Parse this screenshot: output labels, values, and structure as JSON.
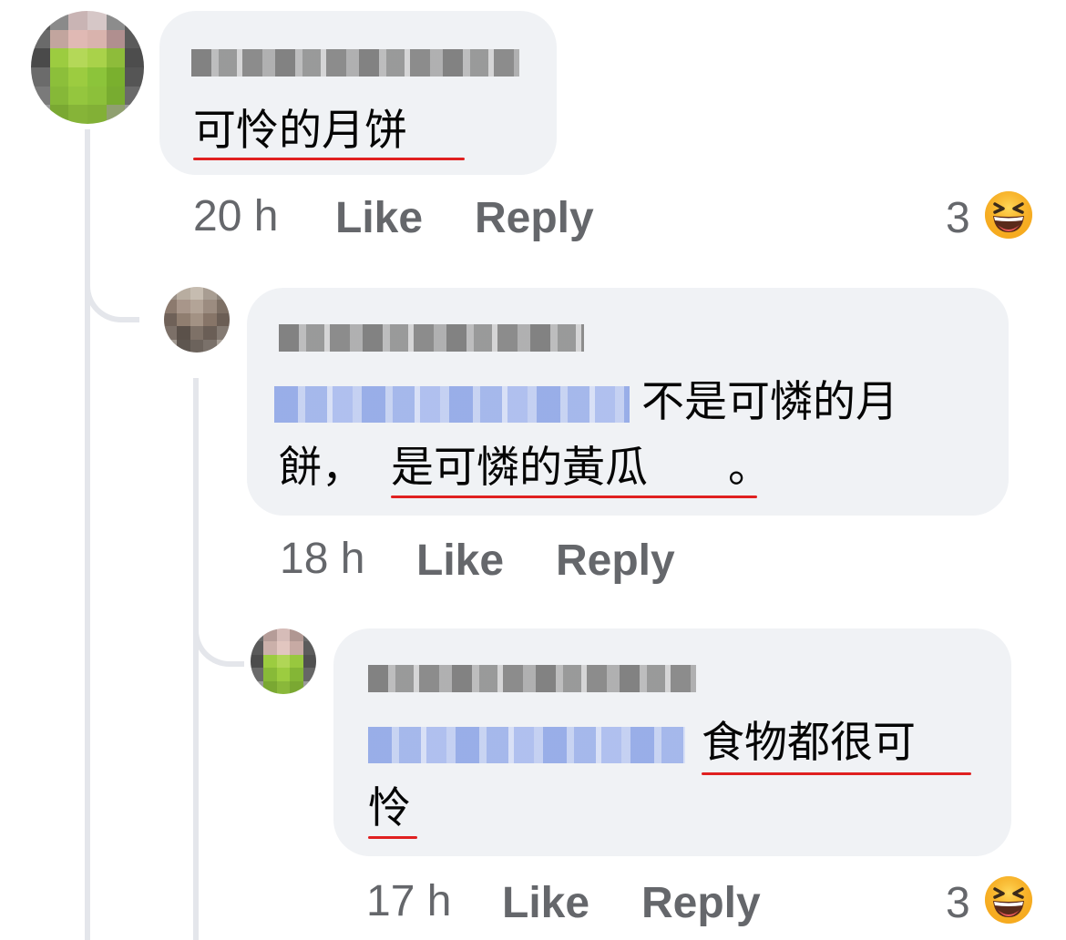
{
  "comments": [
    {
      "text": "可怜的月饼",
      "time": "20 h",
      "like": "Like",
      "reply": "Reply",
      "reaction_count": "3"
    },
    {
      "text_line1": "不是可憐的月",
      "text_line2a": "餅，",
      "text_line2b": "是可憐的黃瓜",
      "text_line2c": "。",
      "time": "18 h",
      "like": "Like",
      "reply": "Reply"
    },
    {
      "text_line1": "食物都很可",
      "text_line2": "怜",
      "time": "17 h",
      "like": "Like",
      "reply": "Reply",
      "reaction_count": "3"
    }
  ],
  "colors": {
    "bubble": "#f0f2f5",
    "meta": "#65676b",
    "underline": "#e02020",
    "mention": "#8fa6e6"
  },
  "icons": {
    "reaction": "laughing-emoji-icon"
  }
}
